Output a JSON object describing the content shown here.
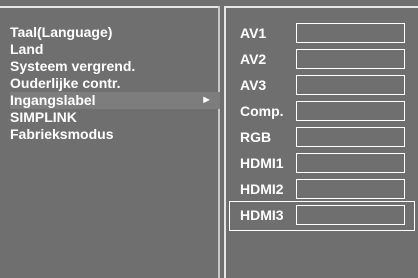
{
  "menu": {
    "items": [
      {
        "label": "Taal(Language)"
      },
      {
        "label": "Land"
      },
      {
        "label": "Systeem vergrend."
      },
      {
        "label": "Ouderlijke contr."
      },
      {
        "label": "Ingangslabel",
        "arrow": "►"
      },
      {
        "label": "SIMPLINK"
      },
      {
        "label": "Fabrieksmodus"
      }
    ],
    "selected_index": 4
  },
  "inputs": [
    {
      "label": "AV1",
      "value": ""
    },
    {
      "label": "AV2",
      "value": ""
    },
    {
      "label": "AV3",
      "value": ""
    },
    {
      "label": "Comp.",
      "value": ""
    },
    {
      "label": "RGB",
      "value": ""
    },
    {
      "label": "HDMI1",
      "value": ""
    },
    {
      "label": "HDMI2",
      "value": ""
    },
    {
      "label": "HDMI3",
      "value": ""
    }
  ],
  "selected_input_index": 7,
  "colors": {
    "background": "#6f6f6f",
    "text": "#ffffff",
    "border": "#e6e6e6"
  }
}
